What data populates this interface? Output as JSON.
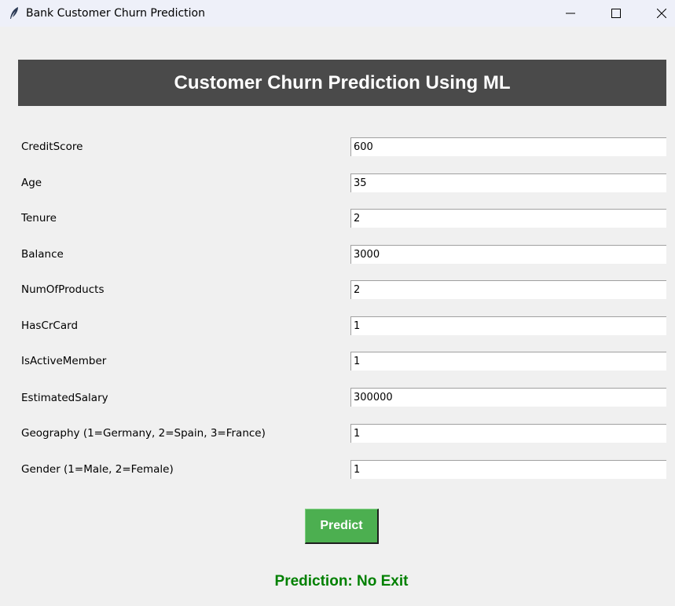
{
  "window": {
    "title": "Bank Customer Churn Prediction",
    "icon": "feather-icon"
  },
  "header": {
    "title": "Customer Churn Prediction Using ML",
    "background": "#4a4a4a"
  },
  "fields": [
    {
      "label": "CreditScore",
      "value": "600"
    },
    {
      "label": "Age",
      "value": "35"
    },
    {
      "label": "Tenure",
      "value": "2"
    },
    {
      "label": "Balance",
      "value": "3000"
    },
    {
      "label": "NumOfProducts",
      "value": "2"
    },
    {
      "label": "HasCrCard",
      "value": "1"
    },
    {
      "label": "IsActiveMember",
      "value": "1"
    },
    {
      "label": "EstimatedSalary",
      "value": "300000"
    },
    {
      "label": "Geography (1=Germany, 2=Spain, 3=France)",
      "value": "1"
    },
    {
      "label": "Gender (1=Male, 2=Female)",
      "value": "1"
    }
  ],
  "predict_button": {
    "label": "Predict",
    "color": "#4caf50"
  },
  "result": {
    "text": "Prediction: No Exit",
    "color": "#008000"
  }
}
